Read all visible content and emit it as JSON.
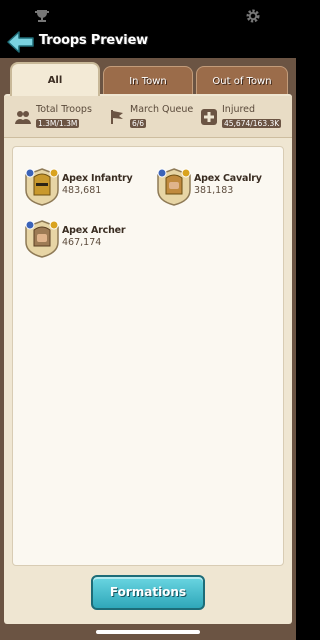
{
  "header": {
    "title": "Troops Preview"
  },
  "tabs": [
    {
      "label": "All",
      "selected": true
    },
    {
      "label": "In Town",
      "selected": false
    },
    {
      "label": "Out of Town",
      "selected": false
    }
  ],
  "stats": {
    "total": {
      "label": "Total Troops",
      "value": "1.3M/1.3M"
    },
    "march": {
      "label": "March Queue",
      "value": "6/6"
    },
    "injured": {
      "label": "Injured",
      "value": "45,674/163.3K"
    }
  },
  "troops": [
    {
      "name": "Apex Infantry",
      "count": "483,681"
    },
    {
      "name": "Apex Cavalry",
      "count": "381,183"
    },
    {
      "name": "Apex Archer",
      "count": "467,174"
    }
  ],
  "footer": {
    "formations_label": "Formations"
  },
  "colors": {
    "accent": "#2fa7b9",
    "panel": "#6b5443",
    "sheet": "#efe6d2"
  }
}
